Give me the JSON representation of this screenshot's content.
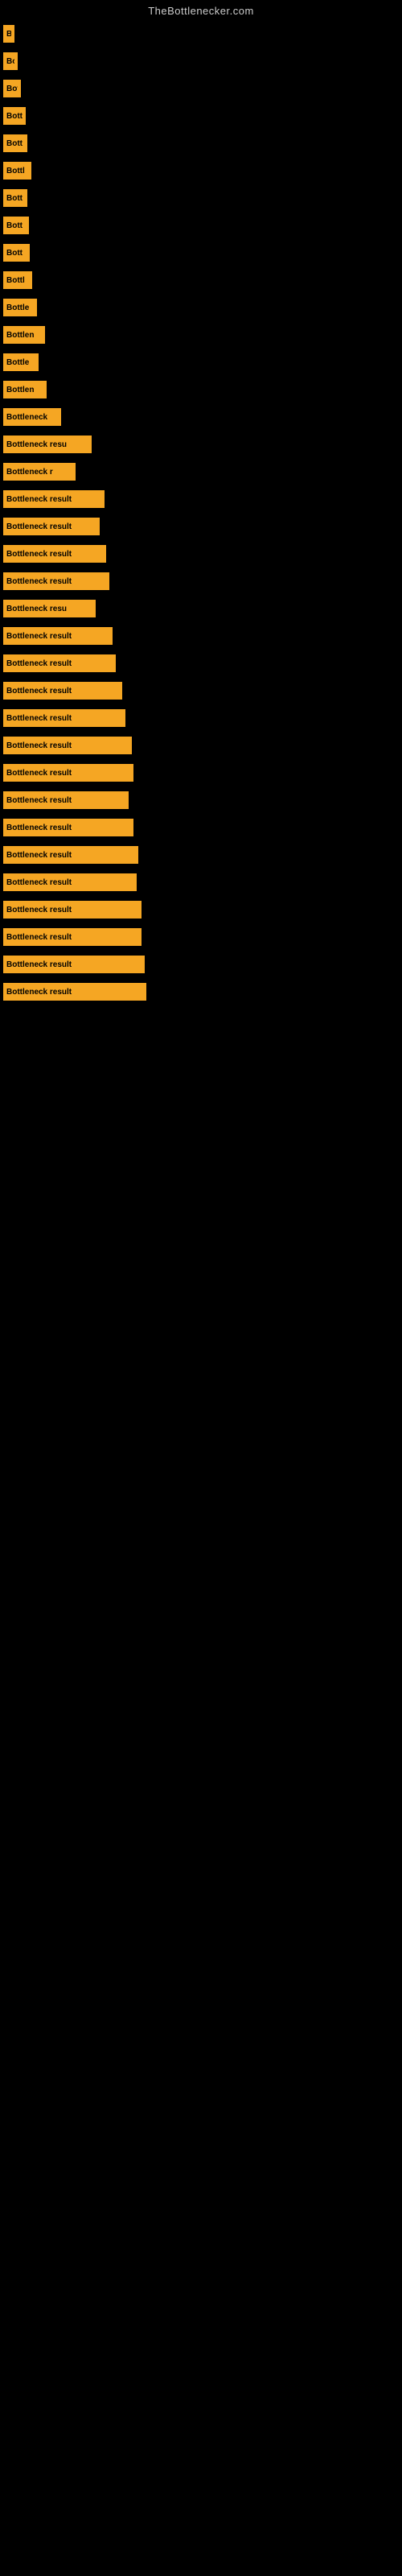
{
  "site_title": "TheBottlenecker.com",
  "bars": [
    {
      "label": "B",
      "width": 14
    },
    {
      "label": "Bo",
      "width": 18
    },
    {
      "label": "Bot",
      "width": 22
    },
    {
      "label": "Bott",
      "width": 28
    },
    {
      "label": "Bott",
      "width": 30
    },
    {
      "label": "Bottl",
      "width": 35
    },
    {
      "label": "Bott",
      "width": 30
    },
    {
      "label": "Bott",
      "width": 32
    },
    {
      "label": "Bott",
      "width": 33
    },
    {
      "label": "Bottl",
      "width": 36
    },
    {
      "label": "Bottle",
      "width": 42
    },
    {
      "label": "Bottlen",
      "width": 52
    },
    {
      "label": "Bottle",
      "width": 44
    },
    {
      "label": "Bottlen",
      "width": 54
    },
    {
      "label": "Bottleneck",
      "width": 72
    },
    {
      "label": "Bottleneck resu",
      "width": 110
    },
    {
      "label": "Bottleneck r",
      "width": 90
    },
    {
      "label": "Bottleneck result",
      "width": 126
    },
    {
      "label": "Bottleneck result",
      "width": 120
    },
    {
      "label": "Bottleneck result",
      "width": 128
    },
    {
      "label": "Bottleneck result",
      "width": 132
    },
    {
      "label": "Bottleneck resu",
      "width": 115
    },
    {
      "label": "Bottleneck result",
      "width": 136
    },
    {
      "label": "Bottleneck result",
      "width": 140
    },
    {
      "label": "Bottleneck result",
      "width": 148
    },
    {
      "label": "Bottleneck result",
      "width": 152
    },
    {
      "label": "Bottleneck result",
      "width": 160
    },
    {
      "label": "Bottleneck result",
      "width": 162
    },
    {
      "label": "Bottleneck result",
      "width": 156
    },
    {
      "label": "Bottleneck result",
      "width": 162
    },
    {
      "label": "Bottleneck result",
      "width": 168
    },
    {
      "label": "Bottleneck result",
      "width": 166
    },
    {
      "label": "Bottleneck result",
      "width": 172
    },
    {
      "label": "Bottleneck result",
      "width": 172
    },
    {
      "label": "Bottleneck result",
      "width": 176
    },
    {
      "label": "Bottleneck result",
      "width": 178
    }
  ]
}
